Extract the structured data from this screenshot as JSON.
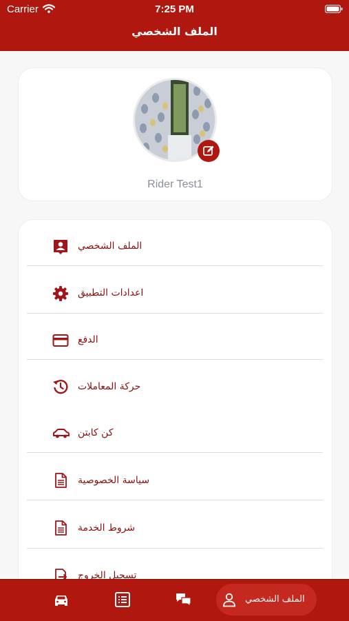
{
  "status_bar": {
    "carrier": "Carrier",
    "time": "7:25 PM"
  },
  "header": {
    "title": "الملف الشخصي"
  },
  "profile": {
    "name": "Rider Test1"
  },
  "menu": {
    "items": [
      {
        "label": "الملف الشخصي",
        "icon": "user-card-icon"
      },
      {
        "label": "اعدادات التطبيق",
        "icon": "gear-icon"
      },
      {
        "label": "الدفع",
        "icon": "credit-card-icon"
      },
      {
        "label": "حركة المعاملات",
        "icon": "history-icon"
      },
      {
        "label": "كن كابتن",
        "icon": "car-icon"
      },
      {
        "label": "سياسة الخصوصية",
        "icon": "document-icon"
      },
      {
        "label": "شروط الخدمة",
        "icon": "document-icon"
      },
      {
        "label": "تسجيل الخروج",
        "icon": "logout-icon"
      }
    ]
  },
  "tabbar": {
    "tabs": [
      {
        "icon": "car-icon"
      },
      {
        "icon": "list-icon"
      },
      {
        "icon": "chat-icon"
      },
      {
        "icon": "person-icon",
        "label": "الملف الشخصي"
      }
    ]
  },
  "colors": {
    "brand": "#b0170f",
    "text_accent": "#8a1010"
  }
}
